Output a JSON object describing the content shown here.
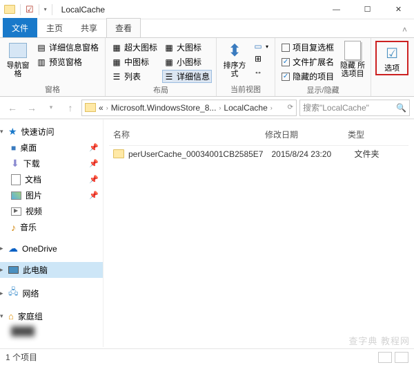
{
  "window": {
    "title": "LocalCache"
  },
  "tabs": {
    "file": "文件",
    "home": "主页",
    "share": "共享",
    "view": "查看"
  },
  "ribbon": {
    "panes_group": "窗格",
    "nav_pane": "导航窗格",
    "detail_pane": "详细信息窗格",
    "preview_pane": "预览窗格",
    "layout_group": "布局",
    "xl_icons": "超大图标",
    "lg_icons": "大图标",
    "md_icons": "中图标",
    "sm_icons": "小图标",
    "list": "列表",
    "details": "详细信息",
    "current_view_group": "当前视图",
    "sort": "排序方式",
    "showhide_group": "显示/隐藏",
    "chk_item": "项目复选框",
    "chk_ext": "文件扩展名",
    "chk_hidden": "隐藏的项目",
    "hide": "隐藏\n所选项目",
    "options": "选项"
  },
  "addr": {
    "ellipsis": "«",
    "crumb1": "Microsoft.WindowsStore_8...",
    "crumb2": "LocalCache"
  },
  "search": {
    "placeholder": "搜索\"LocalCache\""
  },
  "sidebar": {
    "quick": "快速访问",
    "desktop": "桌面",
    "downloads": "下载",
    "documents": "文档",
    "pictures": "图片",
    "videos": "视频",
    "music": "音乐",
    "onedrive": "OneDrive",
    "thispc": "此电脑",
    "network": "网络",
    "homegroup": "家庭组",
    "hidden": "████"
  },
  "columns": {
    "name": "名称",
    "date": "修改日期",
    "type": "类型"
  },
  "rows": [
    {
      "name": "perUserCache_00034001CB2585E7",
      "date": "2015/8/24 23:20",
      "type": "文件夹"
    }
  ],
  "status": {
    "count": "1 个项目"
  },
  "watermark": "查字典  教程网"
}
